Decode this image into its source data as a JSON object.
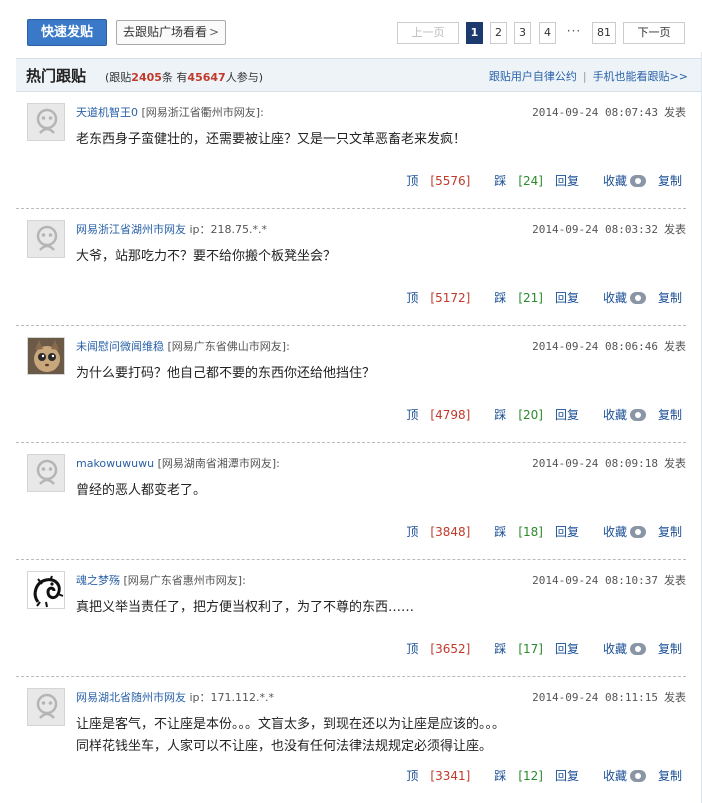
{
  "toolbar": {
    "post_button": "快速发贴",
    "square_button": "去跟贴广场看看",
    "square_chevron": ">"
  },
  "pager": {
    "prev": "上一页",
    "pages": [
      "1",
      "2",
      "3",
      "4"
    ],
    "current": "1",
    "ellipsis": "···",
    "last": "81",
    "next": "下一页"
  },
  "section": {
    "title": "热门跟贴",
    "stats_prefix": "(跟贴",
    "post_count": "2405",
    "stats_mid": "条 有",
    "participant_count": "45647",
    "stats_suffix": "人参与)",
    "link_convention": "跟贴用户自律公约",
    "link_separator": "|",
    "link_mobile": "手机也能看跟贴>>"
  },
  "posts": [
    {
      "username": "天道机智王0",
      "location": "[网易浙江省衢州市网友]:",
      "ip": "",
      "time": "2014-09-24 08:07:43",
      "action": "发表",
      "content": [
        "老东西身子蛮健壮的，还需要被让座？又是一只文革恶畜老来发疯！"
      ],
      "avatar": "default-avatar",
      "up_label": "顶",
      "up_count": "[5576]",
      "down_label": "踩",
      "down_count": "[24]",
      "reply": "回复",
      "favorite": "收藏",
      "copy": "复制"
    },
    {
      "username": "网易浙江省湖州市网友",
      "location": "",
      "ip": "ip：218.75.*.*",
      "time": "2014-09-24 08:03:32",
      "action": "发表",
      "content": [
        "大爷，站那吃力不？要不给你搬个板凳坐会？"
      ],
      "avatar": "default-avatar",
      "up_label": "顶",
      "up_count": "[5172]",
      "down_label": "踩",
      "down_count": "[21]",
      "reply": "回复",
      "favorite": "收藏",
      "copy": "复制"
    },
    {
      "username": "未闻慰问微闻维稳",
      "location": "[网易广东省佛山市网友]:",
      "ip": "",
      "time": "2014-09-24 08:06:46",
      "action": "发表",
      "content": [
        "为什么要打码？他自己都不要的东西你还给他挡住？"
      ],
      "avatar": "cat-avatar",
      "up_label": "顶",
      "up_count": "[4798]",
      "down_label": "踩",
      "down_count": "[20]",
      "reply": "回复",
      "favorite": "收藏",
      "copy": "复制"
    },
    {
      "username": "makowuwuwu",
      "location": "[网易湖南省湘潭市网友]:",
      "ip": "",
      "time": "2014-09-24 08:09:18",
      "action": "发表",
      "content": [
        "曾经的恶人都变老了。"
      ],
      "avatar": "default-avatar",
      "up_label": "顶",
      "up_count": "[3848]",
      "down_label": "踩",
      "down_count": "[18]",
      "reply": "回复",
      "favorite": "收藏",
      "copy": "复制"
    },
    {
      "username": "魂之梦殇",
      "location": "[网易广东省惠州市网友]:",
      "ip": "",
      "time": "2014-09-24 08:10:37",
      "action": "发表",
      "content": [
        "真把义举当责任了，把方便当权利了，为了不尊的东西……"
      ],
      "avatar": "dragon-avatar",
      "up_label": "顶",
      "up_count": "[3652]",
      "down_label": "踩",
      "down_count": "[17]",
      "reply": "回复",
      "favorite": "收藏",
      "copy": "复制"
    },
    {
      "username": "网易湖北省随州市网友",
      "location": "",
      "ip": "ip：171.112.*.*",
      "time": "2014-09-24 08:11:15",
      "action": "发表",
      "content": [
        "让座是客气，不让座是本份。。。文盲太多，到现在还以为让座是应该的。。。",
        "同样花钱坐车，人家可以不让座，也没有任何法律法规规定必须得让座。"
      ],
      "avatar": "default-avatar",
      "up_label": "顶",
      "up_count": "[3341]",
      "down_label": "踩",
      "down_count": "[12]",
      "reply": "回复",
      "favorite": "收藏",
      "copy": "复制"
    }
  ]
}
